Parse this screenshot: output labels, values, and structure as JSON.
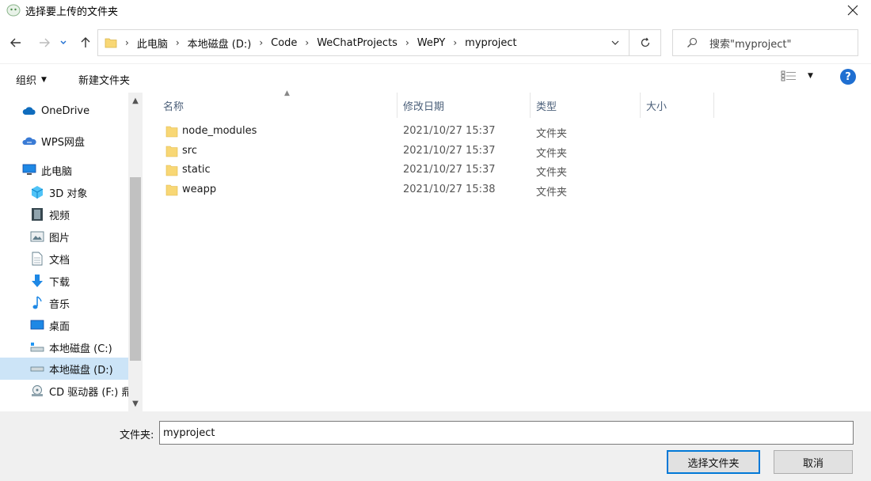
{
  "window": {
    "title": "选择要上传的文件夹"
  },
  "address": {
    "breadcrumb": [
      "此电脑",
      "本地磁盘 (D:)",
      "Code",
      "WeChatProjects",
      "WePY",
      "myproject"
    ]
  },
  "search": {
    "placeholder": "搜索\"myproject\""
  },
  "toolbar": {
    "organize_label": "组织",
    "new_folder_label": "新建文件夹",
    "help_label": "?"
  },
  "navpane": {
    "items": [
      {
        "label": "OneDrive",
        "icon": "cloud-icon"
      },
      {
        "label": "WPS网盘",
        "icon": "wps-cloud-icon"
      },
      {
        "label": "此电脑",
        "icon": "computer-icon"
      },
      {
        "label": "3D 对象",
        "icon": "3d-objects-icon"
      },
      {
        "label": "视频",
        "icon": "video-icon"
      },
      {
        "label": "图片",
        "icon": "pictures-icon"
      },
      {
        "label": "文档",
        "icon": "documents-icon"
      },
      {
        "label": "下载",
        "icon": "download-icon"
      },
      {
        "label": "音乐",
        "icon": "music-icon"
      },
      {
        "label": "桌面",
        "icon": "desktop-icon"
      },
      {
        "label": "本地磁盘 (C:)",
        "icon": "drive-c-icon"
      },
      {
        "label": "本地磁盘 (D:)",
        "icon": "drive-d-icon",
        "selected": true
      },
      {
        "label": "CD 驱动器 (F:) 鼎",
        "icon": "cd-drive-icon"
      }
    ]
  },
  "filelist": {
    "columns": [
      "名称",
      "修改日期",
      "类型",
      "大小"
    ],
    "rows": [
      {
        "name": "node_modules",
        "modified": "2021/10/27 15:37",
        "type": "文件夹",
        "size": ""
      },
      {
        "name": "src",
        "modified": "2021/10/27 15:37",
        "type": "文件夹",
        "size": ""
      },
      {
        "name": "static",
        "modified": "2021/10/27 15:37",
        "type": "文件夹",
        "size": ""
      },
      {
        "name": "weapp",
        "modified": "2021/10/27 15:38",
        "type": "文件夹",
        "size": ""
      }
    ]
  },
  "bottom": {
    "folder_label": "文件夹:",
    "folder_value": "myproject",
    "select_button": "选择文件夹",
    "cancel_button": "取消"
  },
  "colors": {
    "selection": "#cce4f7",
    "accent": "#0078d7",
    "folder": "#f8d775",
    "header_text": "#4c607a"
  }
}
